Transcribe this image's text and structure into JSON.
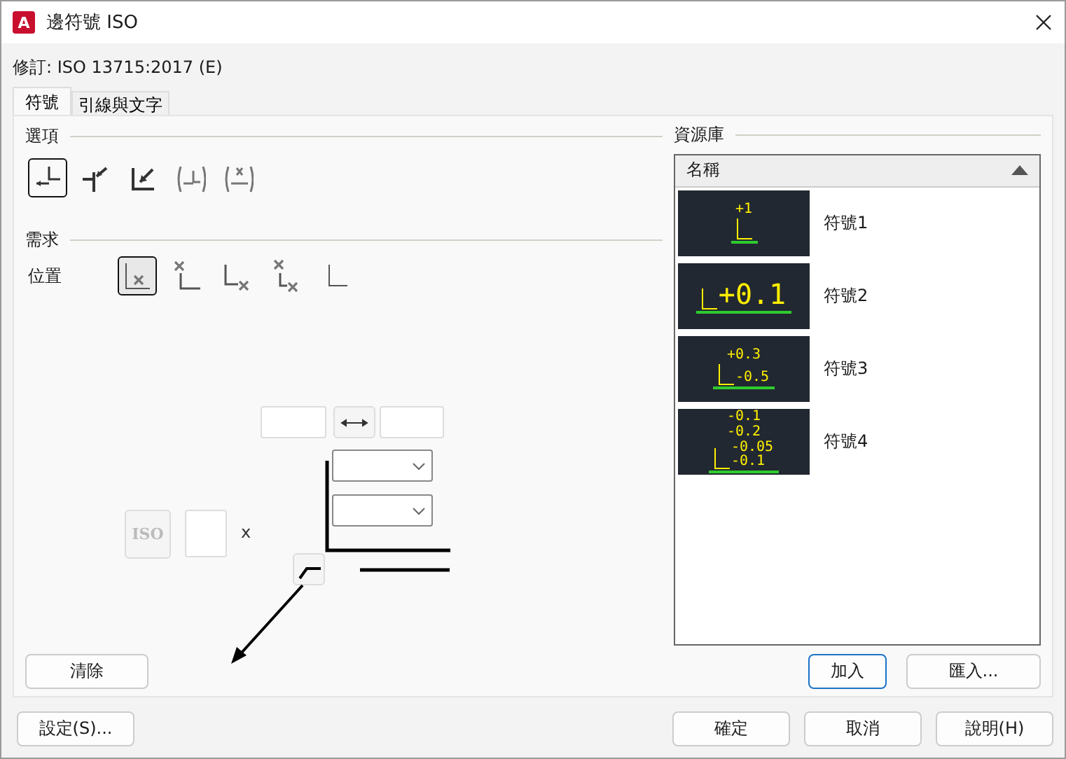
{
  "window": {
    "title": "邊符號 ISO",
    "icon_letter": "A"
  },
  "revision": "修訂: ISO 13715:2017 (E)",
  "tabs": [
    {
      "label": "符號",
      "selected": true
    },
    {
      "label": "引線與文字",
      "selected": false
    }
  ],
  "options": {
    "title": "選項",
    "items": [
      {
        "selected": true
      },
      {
        "selected": false
      },
      {
        "selected": false
      },
      {
        "selected": false
      },
      {
        "selected": false
      }
    ]
  },
  "requirements": {
    "title": "需求",
    "position_label": "位置",
    "positions": [
      {
        "selected": true
      },
      {
        "selected": false
      },
      {
        "selected": false
      },
      {
        "selected": false
      },
      {
        "selected": false
      }
    ]
  },
  "editor": {
    "iso_button": {
      "label": "ISO",
      "disabled": true
    },
    "x_label": "x"
  },
  "clear_button": "清除",
  "library": {
    "title": "資源庫",
    "column": "名稱",
    "items": [
      {
        "name": "符號1",
        "upper": [
          "+1"
        ]
      },
      {
        "name": "符號2",
        "lower": [
          "+0.1"
        ]
      },
      {
        "name": "符號3",
        "upper": [
          "+0.3"
        ],
        "lower": [
          "-0.5"
        ]
      },
      {
        "name": "符號4",
        "upper": [
          "-0.1",
          "-0.2"
        ],
        "lower": [
          "-0.05",
          "-0.1"
        ]
      }
    ],
    "buttons": [
      {
        "label": "加入",
        "default": true
      },
      {
        "label": "匯入...",
        "default": false
      }
    ]
  },
  "footer": {
    "left": "設定(S)...",
    "right": [
      "確定",
      "取消",
      "說明(H)"
    ]
  }
}
